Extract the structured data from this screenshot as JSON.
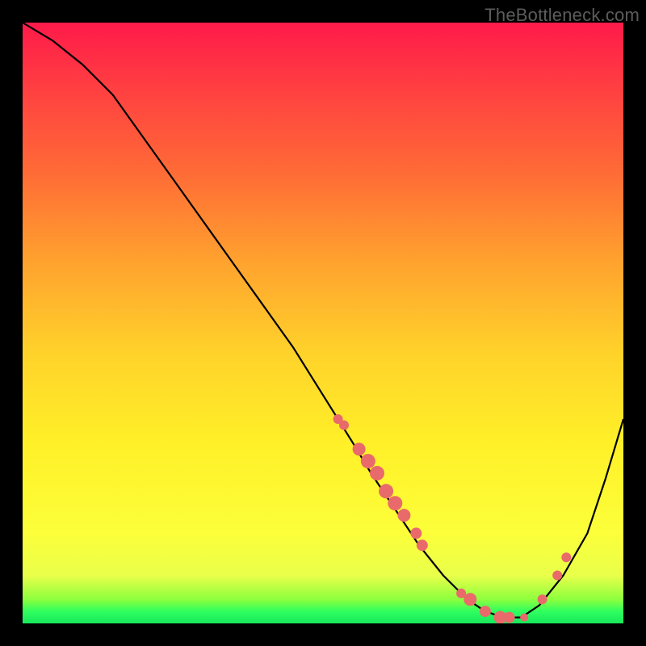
{
  "watermark": "TheBottleneck.com",
  "colors": {
    "bg": "#000000",
    "curve": "#000000",
    "marker": "#e96a6a",
    "gradient": [
      "#ff1a4a",
      "#ff6b36",
      "#ffd22a",
      "#fcff3a",
      "#2fff5e"
    ]
  },
  "chart_data": {
    "type": "line",
    "title": "",
    "xlabel": "",
    "ylabel": "",
    "xlim": [
      0,
      1
    ],
    "ylim": [
      0,
      1
    ],
    "grid": false,
    "legend": false,
    "series": [
      {
        "name": "curve",
        "x": [
          0.0,
          0.05,
          0.1,
          0.15,
          0.2,
          0.25,
          0.3,
          0.35,
          0.4,
          0.45,
          0.5,
          0.55,
          0.58,
          0.62,
          0.66,
          0.7,
          0.74,
          0.77,
          0.8,
          0.83,
          0.86,
          0.9,
          0.94,
          0.97,
          1.0
        ],
        "y": [
          1.0,
          0.97,
          0.93,
          0.88,
          0.81,
          0.74,
          0.67,
          0.6,
          0.53,
          0.46,
          0.38,
          0.3,
          0.25,
          0.19,
          0.13,
          0.08,
          0.04,
          0.02,
          0.01,
          0.01,
          0.03,
          0.08,
          0.15,
          0.24,
          0.34
        ]
      }
    ],
    "markers": [
      {
        "x": 0.525,
        "y": 0.34,
        "r": 6
      },
      {
        "x": 0.535,
        "y": 0.33,
        "r": 6
      },
      {
        "x": 0.56,
        "y": 0.29,
        "r": 8
      },
      {
        "x": 0.575,
        "y": 0.27,
        "r": 9
      },
      {
        "x": 0.59,
        "y": 0.25,
        "r": 9
      },
      {
        "x": 0.605,
        "y": 0.22,
        "r": 9
      },
      {
        "x": 0.62,
        "y": 0.2,
        "r": 9
      },
      {
        "x": 0.635,
        "y": 0.18,
        "r": 8
      },
      {
        "x": 0.655,
        "y": 0.15,
        "r": 7
      },
      {
        "x": 0.665,
        "y": 0.13,
        "r": 7
      },
      {
        "x": 0.73,
        "y": 0.05,
        "r": 6
      },
      {
        "x": 0.745,
        "y": 0.04,
        "r": 8
      },
      {
        "x": 0.77,
        "y": 0.02,
        "r": 7
      },
      {
        "x": 0.795,
        "y": 0.01,
        "r": 8
      },
      {
        "x": 0.81,
        "y": 0.01,
        "r": 7
      },
      {
        "x": 0.835,
        "y": 0.01,
        "r": 5
      },
      {
        "x": 0.865,
        "y": 0.04,
        "r": 6
      },
      {
        "x": 0.89,
        "y": 0.08,
        "r": 6
      },
      {
        "x": 0.905,
        "y": 0.11,
        "r": 6
      }
    ]
  }
}
